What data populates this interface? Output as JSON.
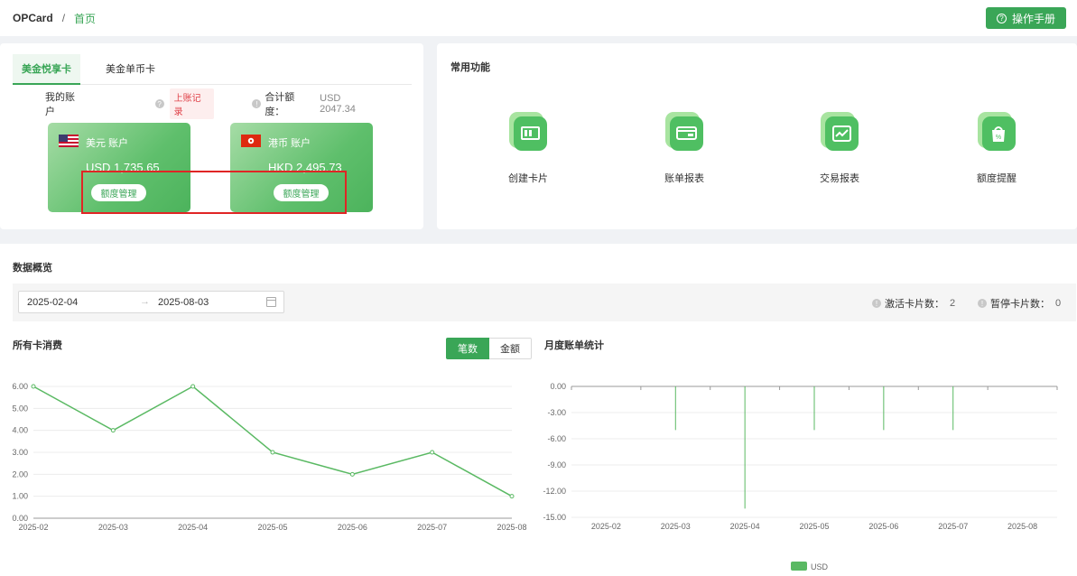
{
  "header": {
    "root": "OPCard",
    "separator": "/",
    "current": "首页",
    "manual_label": "操作手册",
    "manual_icon": "question-circle-icon"
  },
  "accounts": {
    "tabs": [
      "美金悦享卡",
      "美金单币卡"
    ],
    "my_account_label": "我的账户",
    "record_tag": "上账记录",
    "total_label": "合计额度：",
    "total_value": "USD 2047.34",
    "cards": [
      {
        "flag": "us-flag-icon",
        "name": "美元 账户",
        "amount": "USD 1,735.65",
        "button": "额度管理"
      },
      {
        "flag": "hk-flag-icon",
        "name": "港币 账户",
        "amount": "HKD 2,495.73",
        "button": "额度管理"
      }
    ]
  },
  "functions": {
    "title": "常用功能",
    "items": [
      {
        "label": "创建卡片",
        "icon": "create-card-icon"
      },
      {
        "label": "账单报表",
        "icon": "bill-report-icon"
      },
      {
        "label": "交易报表",
        "icon": "transaction-report-icon"
      },
      {
        "label": "额度提醒",
        "icon": "quota-alert-icon"
      }
    ]
  },
  "overview": {
    "title": "数据概览",
    "date_start": "2025-02-04",
    "date_arrow": "→",
    "date_end": "2025-08-03",
    "active_label": "激活卡片数：",
    "active_value": "2",
    "paused_label": "暂停卡片数：",
    "paused_value": "0",
    "consumption_title": "所有卡消费",
    "toggle_count": "笔数",
    "toggle_amount": "金额",
    "monthly_title": "月度账单统计",
    "colors": {
      "primary": "#3aa657",
      "line": "#5ab963"
    }
  },
  "chart_data": [
    {
      "type": "line",
      "title": "所有卡消费",
      "categories": [
        "2025-02",
        "2025-03",
        "2025-04",
        "2025-05",
        "2025-06",
        "2025-07",
        "2025-08"
      ],
      "values": [
        6,
        4,
        6,
        3,
        2,
        3,
        1
      ],
      "yticks": [
        "0.00",
        "1.00",
        "2.00",
        "3.00",
        "4.00",
        "5.00",
        "6.00"
      ],
      "ylim": [
        0,
        6
      ]
    },
    {
      "type": "bar",
      "title": "月度账单统计",
      "categories": [
        "2025-02",
        "2025-03",
        "2025-04",
        "2025-05",
        "2025-06",
        "2025-07",
        "2025-08"
      ],
      "series": [
        {
          "name": "USD",
          "values": [
            0,
            -5,
            -14,
            -5,
            -5,
            -5,
            0
          ]
        }
      ],
      "yticks": [
        "0.00",
        "-3.00",
        "-6.00",
        "-9.00",
        "-12.00",
        "-15.00"
      ],
      "ylim": [
        -15,
        0
      ],
      "legend": "bottom-center"
    }
  ]
}
